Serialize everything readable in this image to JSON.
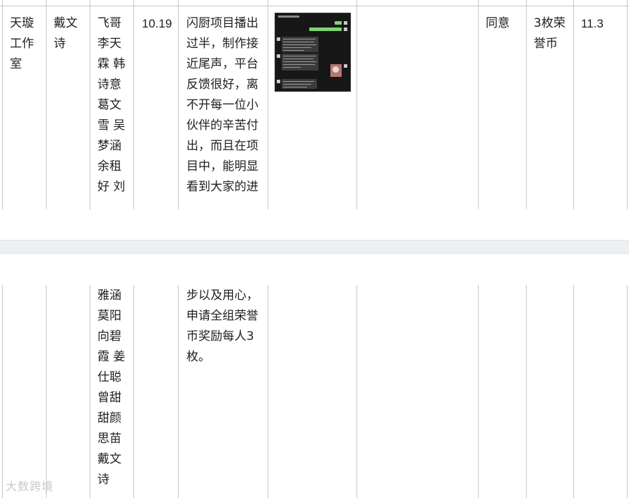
{
  "row": {
    "studio": "天璇工作室",
    "applicant": "戴文诗",
    "members_page1": "飞哥李天霖 韩诗意葛文雪 吴梦涵余租好 刘",
    "members_page2": "雅涵莫阳向碧霞 姜仕聪曾甜甜颜思苗戴文诗",
    "date": "10.19",
    "reason_page1": "闪厨项目播出过半，制作接近尾声，平台反馈很好，离不开每一位小伙伴的辛苦付出，而且在项目中，能明显看到大家的进",
    "reason_page2": "步以及用心，申请全组荣誉币奖励每人3枚。",
    "approval": "同意",
    "reward": "3枚荣誉币",
    "grant_date": "11.3"
  },
  "attachment": {
    "name": "chat-screenshot"
  },
  "watermark": "大数跨境"
}
